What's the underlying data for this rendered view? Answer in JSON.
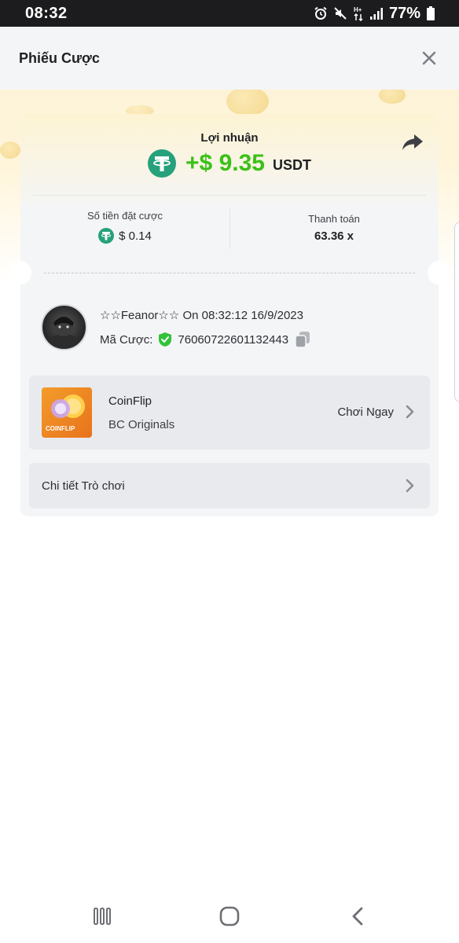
{
  "status_bar": {
    "time": "08:32",
    "battery": "77%",
    "icons": [
      "alarm-icon",
      "mute-icon",
      "data-icon",
      "signal-icon",
      "battery-icon"
    ]
  },
  "header": {
    "title": "Phiếu Cược",
    "close_icon": "close-icon"
  },
  "profit": {
    "label": "Lợi nhuận",
    "amount": "+$ 9.35",
    "currency": "USDT",
    "amount_color": "#3bc117",
    "currency_icon": "tether-icon"
  },
  "stats": {
    "bet_label": "Số tiền đặt cược",
    "bet_value": "$ 0.14",
    "payout_label": "Thanh toán",
    "payout_value": "63.36 x"
  },
  "user": {
    "name": "☆☆Feanor☆☆",
    "time": "On 08:32:12 16/9/2023",
    "bet_id_label": "Mã Cược:",
    "bet_id": "76060722601132443"
  },
  "game": {
    "name": "CoinFlip",
    "provider": "BC Originals",
    "play_label": "Chơi Ngay",
    "thumb_text": "COINFLIP"
  },
  "details": {
    "label": "Chi tiết Trò chơi"
  },
  "colors": {
    "accent_green": "#3bc117",
    "tether": "#26a17b",
    "shield": "#32c23a"
  }
}
